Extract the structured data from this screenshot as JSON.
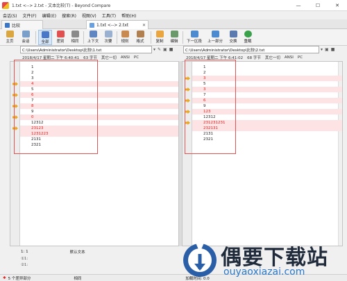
{
  "window": {
    "title": "1.txt <--> 2.txt - 文本比较(T) - Beyond Compare",
    "minimize": "—",
    "maximize": "☐",
    "close": "✕"
  },
  "menu": [
    "会话(S)",
    "文件(F)",
    "编辑(E)",
    "搜索(R)",
    "视图(V)",
    "工具(T)",
    "帮助(H)"
  ],
  "tabs": [
    {
      "label": "比较"
    },
    {
      "label": "1.txt <--> 2.txt",
      "close": "✕"
    }
  ],
  "toolbar": {
    "home": "主页",
    "session": "会话",
    "all": "全部",
    "diffs": "差别",
    "same": "相同",
    "context": "上下文",
    "minor": "次要",
    "rules": "规则",
    "format": "格式",
    "copy": "复制",
    "edit": "编辑",
    "next_section": "下一区段",
    "prev_section": "上一部分",
    "swap": "交换",
    "reload": "重载"
  },
  "left": {
    "path": "C:\\Users\\Administrator\\Desktop\\比较\\1.txt",
    "date": "2018/4/17 星期二 下午 6:40:41",
    "size": "63 字节",
    "other": "其它一切",
    "encoding": "ANSI",
    "lineend": "PC",
    "lines": [
      {
        "text": "1",
        "diff": false,
        "arrow": false
      },
      {
        "text": "2",
        "diff": false,
        "arrow": false
      },
      {
        "text": "3",
        "diff": false,
        "arrow": false
      },
      {
        "text": "4",
        "diff": true,
        "arrow": true
      },
      {
        "text": "5",
        "diff": false,
        "arrow": false
      },
      {
        "text": "6",
        "diff": true,
        "arrow": true
      },
      {
        "text": "7",
        "diff": false,
        "arrow": false
      },
      {
        "text": "8",
        "diff": true,
        "arrow": true
      },
      {
        "text": "9",
        "diff": false,
        "arrow": false
      },
      {
        "text": "0",
        "diff": true,
        "arrow": true
      },
      {
        "text": "12312",
        "diff": false,
        "arrow": false
      },
      {
        "text": "23123",
        "diff": true,
        "arrow": true
      },
      {
        "text": "1231223",
        "diff": true,
        "arrow": false
      },
      {
        "text": "2131",
        "diff": false,
        "arrow": false
      },
      {
        "text": "2321",
        "diff": false,
        "arrow": false
      }
    ]
  },
  "right": {
    "path": "C:\\Users\\Administrator\\Desktop\\比较\\2.txt",
    "date": "2018/4/17 星期二 下午 6:41:02",
    "size": "68 字节",
    "other": "其它一切",
    "encoding": "ANSI",
    "lineend": "PC",
    "lines": [
      {
        "text": "1",
        "diff": false,
        "arrow": false
      },
      {
        "text": "2",
        "diff": false,
        "arrow": false
      },
      {
        "text": "3",
        "diff": true,
        "arrow": true
      },
      {
        "text": "5",
        "diff": false,
        "arrow": false
      },
      {
        "text": "3",
        "diff": true,
        "arrow": true
      },
      {
        "text": "7",
        "diff": false,
        "arrow": false
      },
      {
        "text": "6",
        "diff": true,
        "arrow": true
      },
      {
        "text": "9",
        "diff": false,
        "arrow": false
      },
      {
        "text": "123",
        "diff": true,
        "arrow": true
      },
      {
        "text": "12312",
        "diff": false,
        "arrow": false
      },
      {
        "text": "231231231",
        "diff": true,
        "arrow": true
      },
      {
        "text": "232131",
        "diff": true,
        "arrow": false
      },
      {
        "text": "2131",
        "diff": false,
        "arrow": false
      },
      {
        "text": "2321",
        "diff": false,
        "arrow": false
      }
    ]
  },
  "status": {
    "position": "1: 1",
    "mode": "默认文本",
    "ruler1": "①1:",
    "ruler2": "②1:",
    "diff_count": "5 个差异部分",
    "same_label": "相同",
    "load_time": "加载时间: 0.0"
  },
  "watermark": {
    "title": "偶要下载站",
    "url": "ouyaoxiazai.com"
  },
  "colors": {
    "diff_bg": "#fde3e3",
    "diff_text": "#e02020",
    "arrow": "#e9a722",
    "highlight_box": "#e05353"
  }
}
